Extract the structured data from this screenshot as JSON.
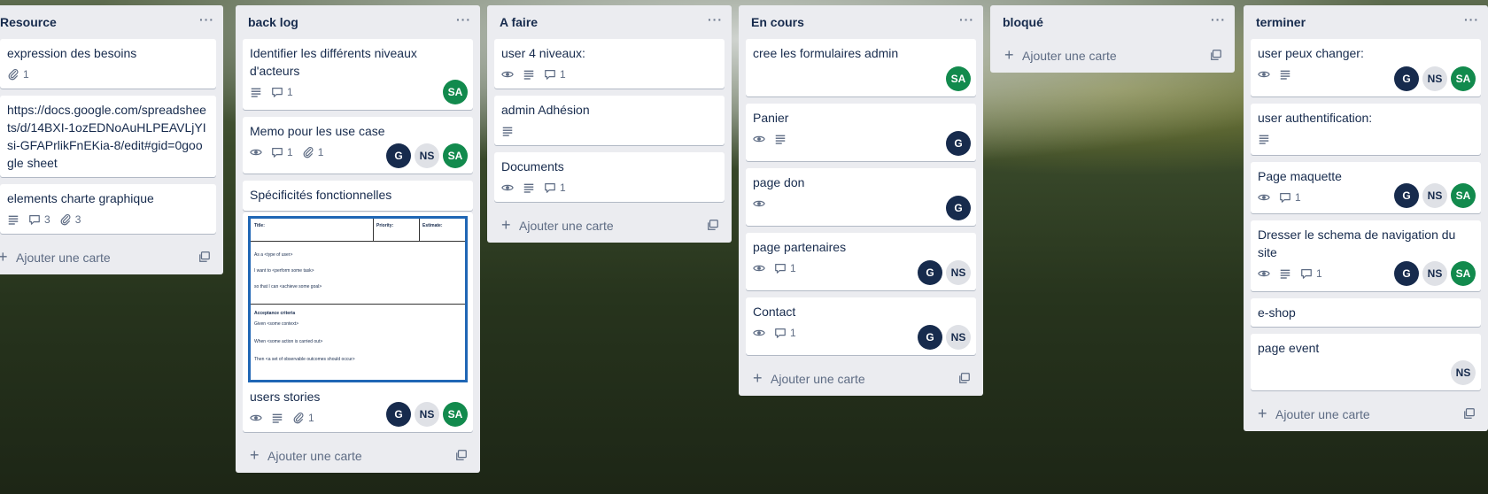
{
  "board": {
    "add_card_label": "Ajouter une carte",
    "menu_glyph": "···",
    "lists": [
      {
        "title": "Resource",
        "cards": [
          {
            "title": "expression des besoins",
            "attachments": "1"
          },
          {
            "title": "https://docs.google.com/spreadsheets/d/14BXI-1ozEDNoAuHLPEAVLjYIsi-GFAPrlikFnEKia-8/edit#gid=0google sheet"
          },
          {
            "title": "elements charte graphique",
            "comments": "3",
            "attachments": "3"
          }
        ]
      },
      {
        "title": "back log",
        "cards": [
          {
            "title": "Identifier les différents niveaux d'acteurs",
            "comments": "1",
            "members": [
              "SA"
            ]
          },
          {
            "title": "Memo pour les use case",
            "comments": "1",
            "attachments": "1",
            "members": [
              "G",
              "NS",
              "SA"
            ]
          },
          {
            "title": "Spécificités fonctionnelles"
          },
          {
            "title": "users stories",
            "attachments": "1",
            "members": [
              "G",
              "NS",
              "SA"
            ],
            "cover": {
              "title": "Title:",
              "priority": "Priority:",
              "estimate": "Estimate:",
              "as_a": "As a <type of user>",
              "i_want": "I want to <perform some task>",
              "so_that": "so that I can <achieve some goal>",
              "acceptance": "Acceptance criteria",
              "given": "Given <some context>",
              "when": "When <some action is carried out>",
              "then": "Then <a set of observable outcomes should occur>"
            }
          }
        ]
      },
      {
        "title": "A faire",
        "cards": [
          {
            "title": "user 4 niveaux:",
            "comments": "1"
          },
          {
            "title": "admin Adhésion"
          },
          {
            "title": "Documents",
            "comments": "1"
          }
        ]
      },
      {
        "title": "En cours",
        "cards": [
          {
            "title": "cree les formulaires admin",
            "members": [
              "SA"
            ]
          },
          {
            "title": "Panier",
            "members": [
              "G"
            ]
          },
          {
            "title": "page don",
            "members": [
              "G"
            ]
          },
          {
            "title": "page partenaires",
            "comments": "1",
            "members": [
              "G",
              "NS"
            ]
          },
          {
            "title": "Contact",
            "comments": "1",
            "members": [
              "G",
              "NS"
            ]
          }
        ]
      },
      {
        "title": "bloqué",
        "cards": []
      },
      {
        "title": "terminer",
        "cards": [
          {
            "title": "user peux changer:",
            "members": [
              "G",
              "NS",
              "SA"
            ]
          },
          {
            "title": "user authentification:"
          },
          {
            "title": "Page maquette",
            "comments": "1",
            "members": [
              "G",
              "NS",
              "SA"
            ]
          },
          {
            "title": "Dresser le schema de navigation du site",
            "comments": "1",
            "members": [
              "G",
              "NS",
              "SA"
            ]
          },
          {
            "title": "e-shop"
          },
          {
            "title": "page event",
            "members": [
              "NS"
            ]
          }
        ]
      }
    ]
  },
  "colors": {
    "avatar_g": "#172b4d",
    "avatar_ns": "#dfe1e6",
    "avatar_sa": "#128a4d",
    "cover_border": "#1f66b5",
    "list_bg": "#ebecf0"
  }
}
